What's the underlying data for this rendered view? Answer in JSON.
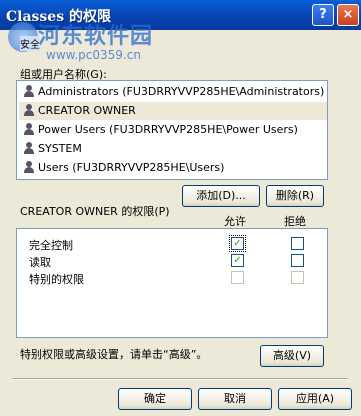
{
  "window": {
    "title": "Classes 的权限",
    "help_glyph": "?",
    "close_glyph": "×"
  },
  "watermark": {
    "title": "河东软件园",
    "url": "www.pc0359.cn"
  },
  "tab": {
    "label": "安全"
  },
  "group_section": {
    "label": "组或用户名称(G):",
    "users": [
      "Administrators (FU3DRRYVVP285HE\\Administrators)",
      "CREATOR OWNER",
      "Power Users (FU3DRRYVVP285HE\\Power Users)",
      "SYSTEM",
      "Users (FU3DRRYVVP285HE\\Users)"
    ],
    "selected_index": 1
  },
  "buttons": {
    "add": "添加(D)...",
    "remove": "删除(R)",
    "advanced": "高级(V)",
    "ok": "确定",
    "cancel": "取消",
    "apply": "应用(A)"
  },
  "permissions": {
    "title": "CREATOR OWNER 的权限(P)",
    "col_allow": "允许",
    "col_deny": "拒绝",
    "rows": [
      {
        "name": "完全控制",
        "allow": "checked",
        "deny": "unchecked"
      },
      {
        "name": "读取",
        "allow": "checked",
        "deny": "unchecked"
      },
      {
        "name": "特别的权限",
        "allow": "disabled",
        "deny": "disabled"
      }
    ]
  },
  "advanced_hint": "特别权限或高级设置，请单击“高级”。",
  "colors": {
    "titlebar": "#0842b0",
    "dialog_bg": "#ece9d8",
    "selection_bg": "#ece9d8",
    "check_green": "#21a121"
  }
}
